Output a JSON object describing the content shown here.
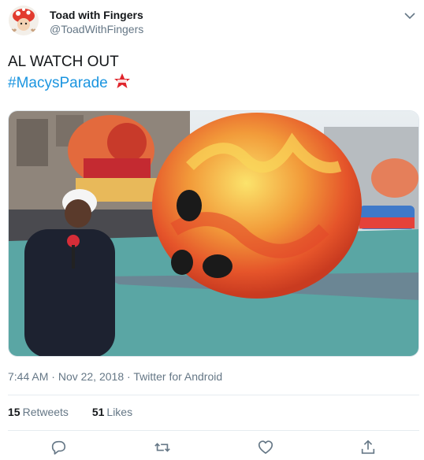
{
  "author": {
    "display_name": "Toad with Fingers",
    "handle": "@ToadWithFingers",
    "avatar_icon": "toad-avatar-icon"
  },
  "tweet": {
    "text_line1": "AL WATCH OUT",
    "hashtag": "#MacysParade",
    "hashtag_emoji_icon": "macys-star-icon"
  },
  "media": {
    "kind": "video-still"
  },
  "meta": {
    "time": "7:44 AM",
    "date": "Nov 22, 2018",
    "source": "Twitter for Android",
    "separator": " · "
  },
  "stats": {
    "retweets_count": "15",
    "retweets_label": "Retweets",
    "likes_count": "51",
    "likes_label": "Likes"
  },
  "actions": [
    "reply-icon",
    "retweet-icon",
    "like-icon",
    "share-icon"
  ],
  "colors": {
    "hashtag": "#1b95e0",
    "secondary_text": "#657786",
    "primary_text": "#14171a",
    "divider": "#e6ecf0"
  }
}
